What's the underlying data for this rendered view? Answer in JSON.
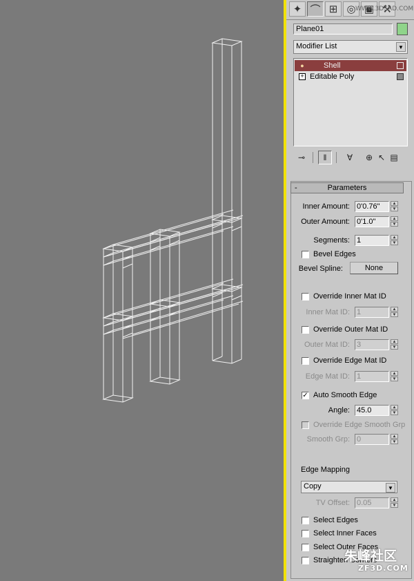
{
  "object_name": "Plane01",
  "object_color": "#8fd48a",
  "modifier_list_label": "Modifier List",
  "stack": [
    {
      "label": "Shell",
      "selected": true
    },
    {
      "label": "Editable Poly",
      "selected": false
    }
  ],
  "rollout_title": "Parameters",
  "params": {
    "inner_amount_label": "Inner Amount:",
    "inner_amount": "0'0.76\"",
    "outer_amount_label": "Outer Amount:",
    "outer_amount": "0'1.0\"",
    "segments_label": "Segments:",
    "segments": "1",
    "bevel_edges_label": "Bevel Edges",
    "bevel_spline_label": "Bevel Spline:",
    "bevel_spline_value": "None",
    "override_inner_label": "Override Inner Mat ID",
    "inner_mat_id_label": "Inner Mat ID:",
    "inner_mat_id": "1",
    "override_outer_label": "Override Outer Mat ID",
    "outer_mat_id_label": "Outer Mat ID:",
    "outer_mat_id": "3",
    "override_edge_label": "Override Edge Mat ID",
    "edge_mat_id_label": "Edge Mat ID:",
    "edge_mat_id": "1",
    "auto_smooth_label": "Auto Smooth Edge",
    "auto_smooth_checked": true,
    "angle_label": "Angle:",
    "angle": "45.0",
    "override_edge_smooth_label": "Override Edge Smooth Grp",
    "smooth_grp_label": "Smooth Grp:",
    "smooth_grp": "0",
    "edge_mapping_label": "Edge Mapping",
    "edge_mapping_value": "Copy",
    "tv_offset_label": "TV Offset:",
    "tv_offset": "0.05",
    "select_edges_label": "Select Edges",
    "select_inner_label": "Select Inner Faces",
    "select_outer_label": "Select Outer Faces",
    "straighten_label": "Straighten Corners"
  },
  "watermark_top": "WWW.3DSAD.COM",
  "watermark_bottom_cn": "朱峰社区",
  "watermark_bottom_en": "ZF3D.COM"
}
